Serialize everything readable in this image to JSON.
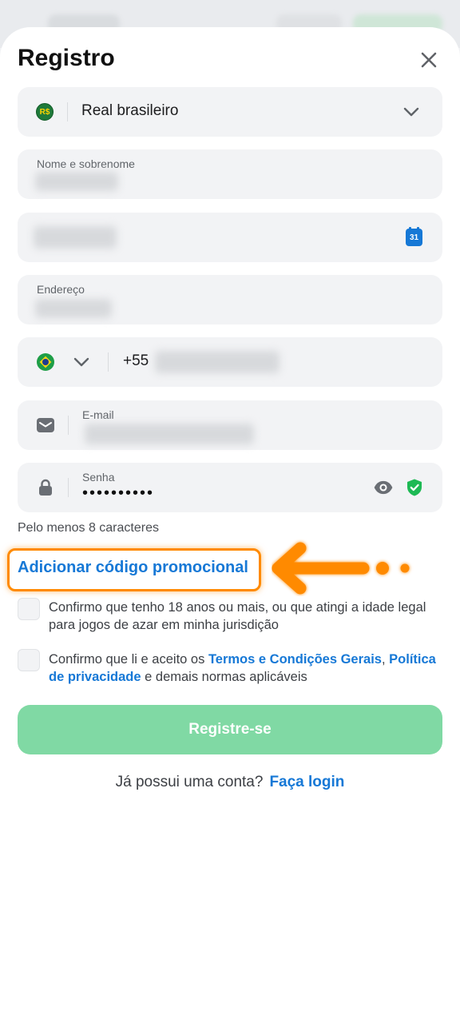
{
  "header": {
    "title": "Registro",
    "close_icon": "close-icon"
  },
  "currency": {
    "badge": "R$",
    "value": "Real brasileiro",
    "icon": "chevron-down-icon"
  },
  "name_field": {
    "label": "Nome e sobrenome"
  },
  "birthdate_field": {
    "calendar_day": "31",
    "icon": "calendar-icon"
  },
  "address_field": {
    "label": "Endereço"
  },
  "phone_field": {
    "country_icon": "brazil-flag-icon",
    "prefix": "+55"
  },
  "email_field": {
    "label": "E-mail",
    "icon": "envelope-icon"
  },
  "password_field": {
    "label": "Senha",
    "value": "••••••••••",
    "icons": [
      "lock-icon",
      "eye-icon",
      "shield-check-icon"
    ]
  },
  "password_hint": "Pelo menos 8 caracteres",
  "promo_link": "Adicionar código promocional",
  "consents": {
    "age": "Confirmo que tenho 18 anos ou mais, ou que atingi a idade legal para jogos de azar em minha jurisdição",
    "terms_prefix": "Confirmo que li e aceito os ",
    "terms_link": "Termos e Condições Gerais",
    "terms_comma": ",",
    "privacy_link": "Política de privacidade",
    "terms_suffix": " e demais normas aplicáveis"
  },
  "submit_label": "Registre-se",
  "login": {
    "question": "Já possui uma conta?",
    "link": "Faça login"
  },
  "colors": {
    "accent_blue": "#1678d6",
    "submit_green": "#80d9a4",
    "highlight_orange": "#ff8a00",
    "field_bg": "#f2f3f5",
    "shield_green": "#1db954"
  }
}
